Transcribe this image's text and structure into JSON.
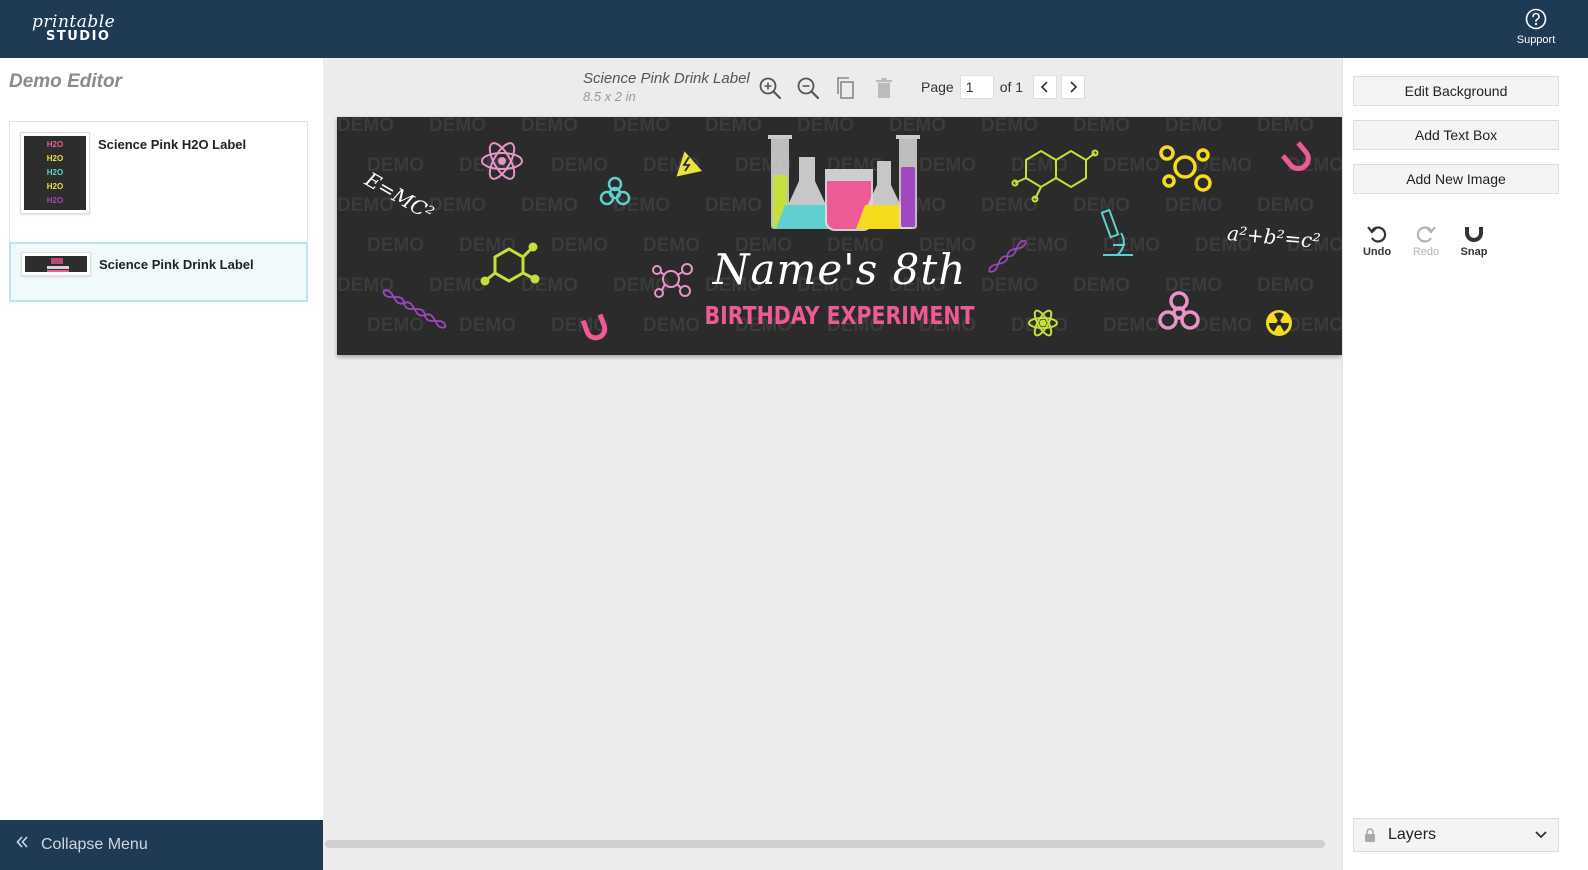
{
  "app": {
    "logo_script": "printable",
    "logo_block": "STUDIO",
    "support_label": "Support"
  },
  "sidebar": {
    "title": "Demo Editor",
    "templates": [
      {
        "name": "Science Pink H2O Label",
        "thumb_text": "H2O"
      },
      {
        "name": "Science Pink Drink Label",
        "active": true
      }
    ],
    "collapse_label": "Collapse Menu"
  },
  "document": {
    "title": "Science Pink Drink Label",
    "size": "8.5 x 2 in",
    "page_label": "Page",
    "page_value": "1",
    "page_total": "of 1"
  },
  "label": {
    "name_text": "Name's 8th",
    "subtitle_text": "BIRTHDAY EXPERIMENT",
    "watermark": "DEMO",
    "equation_1": "E=MC²",
    "equation_2": "a²+b²=c²",
    "background_color": "#2b2b2b",
    "accent_pink": "#ee5a95",
    "accent_yellow": "#e8e23a",
    "accent_teal": "#5fd0cf",
    "accent_purple": "#a048c0"
  },
  "right_panel": {
    "edit_background": "Edit Background",
    "add_text_box": "Add Text Box",
    "add_new_image": "Add New Image",
    "undo": "Undo",
    "redo": "Redo",
    "snap": "Snap",
    "layers": "Layers"
  }
}
